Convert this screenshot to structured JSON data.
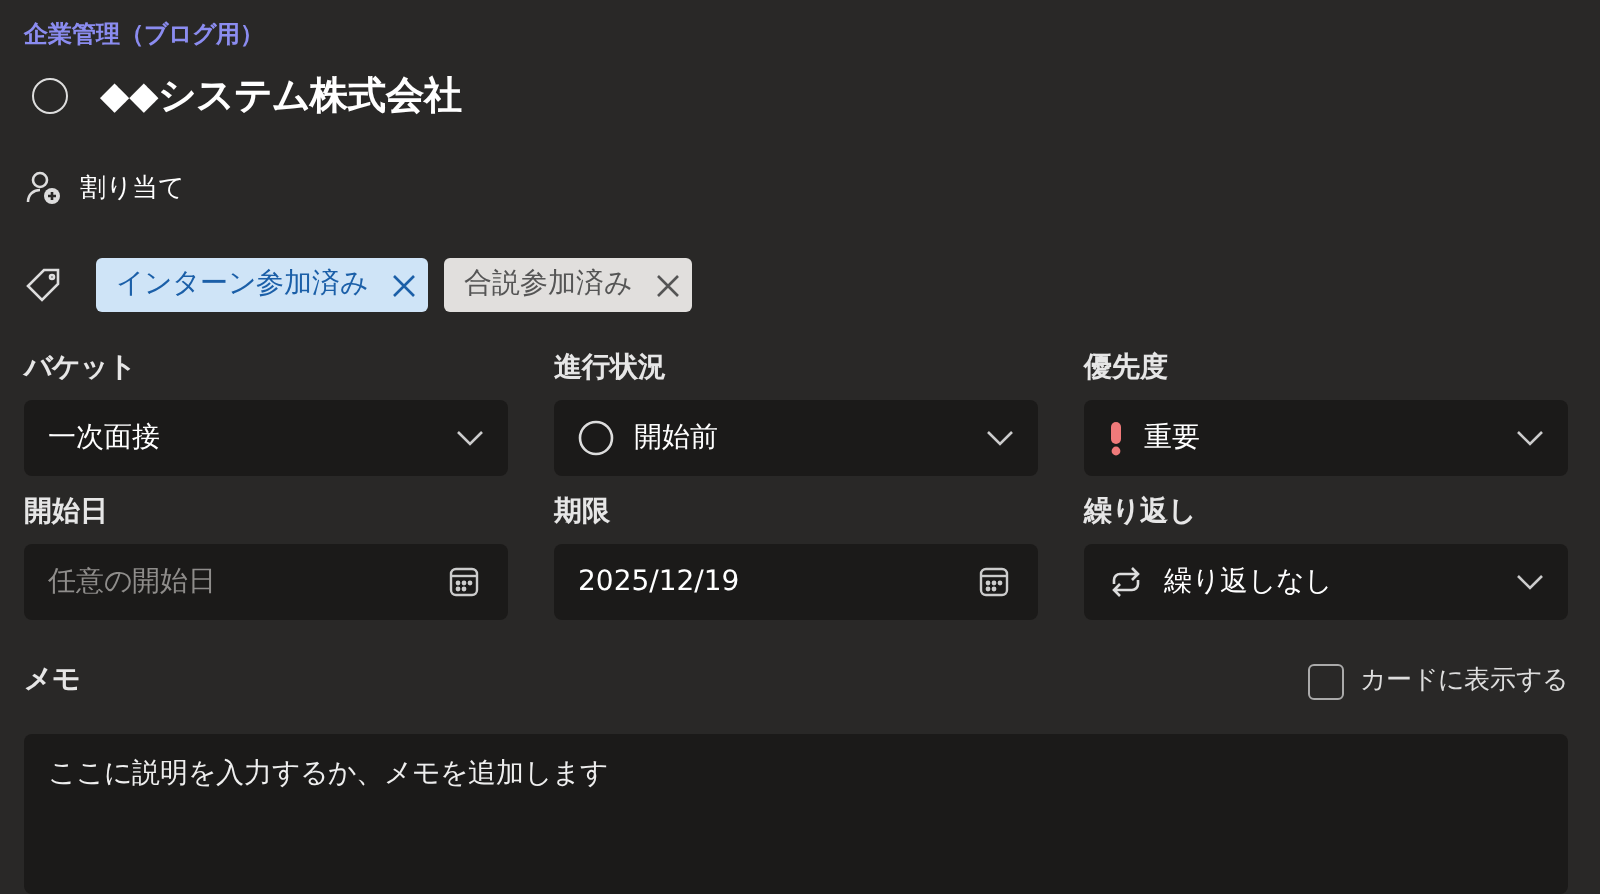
{
  "plan_name": "企業管理（ブログ用）",
  "task": {
    "title": "◆◆システム株式会社",
    "completed": false
  },
  "assign": {
    "label": "割り当て"
  },
  "labels": [
    {
      "text": "インターン参加済み",
      "color": "#cfe4f7"
    },
    {
      "text": "合説参加済み",
      "color": "#e1dfdd"
    }
  ],
  "fields": [
    {
      "label": "バケット",
      "kind": "dropdown",
      "value": "一次面接"
    },
    {
      "label": "進行状況",
      "kind": "dropdown",
      "value": "開始前"
    },
    {
      "label": "優先度",
      "kind": "dropdown",
      "value": "重要"
    },
    {
      "label": "開始日",
      "kind": "date",
      "placeholder": "任意の開始日"
    },
    {
      "label": "期限",
      "kind": "date",
      "value": "2025/12/19"
    },
    {
      "label": "繰り返し",
      "kind": "dropdown",
      "value": "繰り返しなし"
    }
  ],
  "notes": {
    "label": "メモ",
    "show_on_card": {
      "label": "カードに表示する",
      "checked": false
    },
    "value": "ここに説明を入力するか、メモを追加します"
  }
}
